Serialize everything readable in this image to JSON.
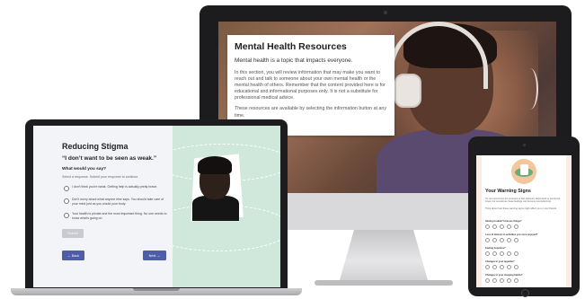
{
  "desktop": {
    "card": {
      "title": "Mental Health Resources",
      "lead": "Mental health is a topic that impacts everyone.",
      "body": "In this section, you will review information that may make you want to reach out and talk to someone about your own mental health or the mental health of others. Remember that the content provided here is for educational and informational purposes only. It is not a substitute for professional medical advice.",
      "footer": "These resources are available by selecting the information button at any time."
    }
  },
  "laptop": {
    "title": "Reducing Stigma",
    "quote": "“I don’t want to be seen as weak.”",
    "question": "What would you say?",
    "hint": "Select a response. Submit your response to continue.",
    "options": [
      "I don’t think you’re weak. Getting help is actually pretty brave.",
      "Don’t worry about what anyone else says. You should take care of your mind just as you would your body.",
      "Your health is private and the most important thing. No one needs to know what’s going on."
    ],
    "submit_label": "Submit",
    "back_label": "← Back",
    "next_label": "Next →"
  },
  "tablet": {
    "title": "Your Warning Signs",
    "intro1": "It’s not uncommon for someone to feel stressed, depressed or worried at times, but sometimes these feelings can become overwhelming.",
    "intro2": "Think about how these warning signs might affect you or your friends.",
    "questions": [
      "Having trouble? How are things?",
      "Loss of interest in activities you once enjoyed?",
      "Feeling hopeless?",
      "Changes in your appetite?",
      "Changes in your sleeping habits?"
    ]
  },
  "colors": {
    "accent_button": "#4f5ca8",
    "laptop_panel": "#cfe8db",
    "tablet_bg": "#f9ece4"
  }
}
